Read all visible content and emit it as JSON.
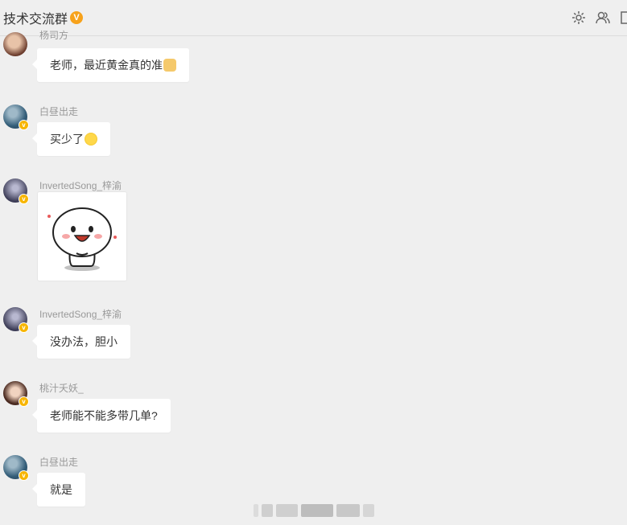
{
  "header": {
    "title": "技术交流群",
    "badge": "V",
    "icons": [
      "gear-icon",
      "members-icon",
      "window-icon"
    ]
  },
  "messages": [
    {
      "sender": "杨司方",
      "text": "老师，最近黄金真的准",
      "emoji": "clapping-hands",
      "avatar_color": "#6a3b2c"
    },
    {
      "sender": "白昼出走",
      "text": "买少了",
      "emoji": "laughing-face",
      "avatar_color": "#355f7a"
    },
    {
      "sender": "InvertedSong_梓渝",
      "text": "",
      "sticker": "happy-bun-sticker",
      "avatar_color": "#3b3b55"
    },
    {
      "sender": "InvertedSong_梓渝",
      "text": "没办法，胆小",
      "avatar_color": "#3b3b55"
    },
    {
      "sender": "桃汁夭妖_",
      "text": "老师能不能多带几单?",
      "avatar_color": "#4a2a20"
    },
    {
      "sender": "白昼出走",
      "text": "就是",
      "avatar_color": "#355f7a"
    }
  ],
  "colors": {
    "accent": "#f7a21b",
    "verify": "#f7b500",
    "background": "#efefef",
    "bubble": "#ffffff"
  }
}
